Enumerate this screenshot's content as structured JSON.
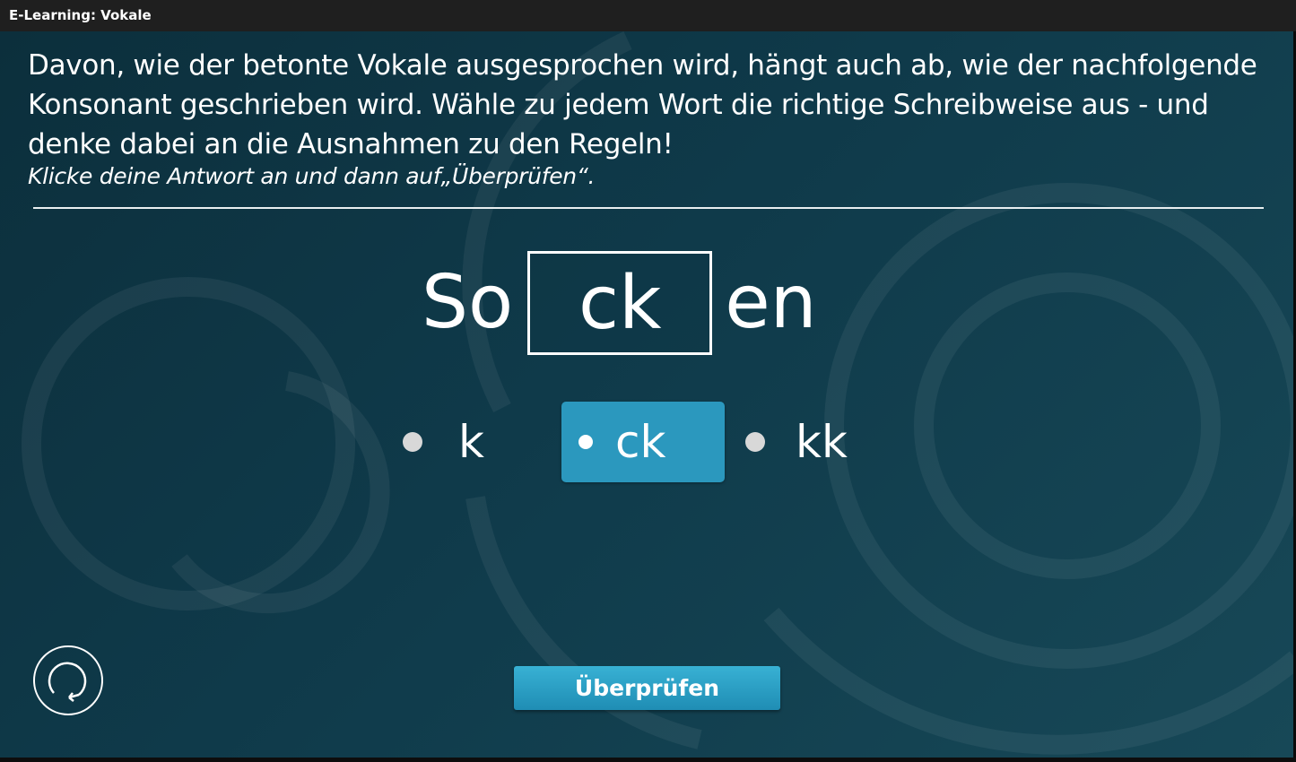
{
  "window": {
    "title": "E-Learning: Vokale"
  },
  "task": {
    "instruction": "Davon, wie der betonte Vokale ausgesprochen wird, hängt auch ab, wie der nachfolgende Konsonant geschrieben wird. Wähle zu jedem Wort die richtige Schreibweise aus - und denke dabei an die Ausnahmen zu den Regeln!",
    "hint": "Klicke deine Antwort an und dann auf„Überprüfen“."
  },
  "word": {
    "prefix": "So",
    "gap_value": "ck",
    "suffix": "en"
  },
  "options": [
    {
      "label": "k",
      "selected": false
    },
    {
      "label": "ck",
      "selected": true
    },
    {
      "label": "kk",
      "selected": false
    }
  ],
  "buttons": {
    "check_label": "Überprüfen",
    "reset_icon": "reset-icon"
  },
  "colors": {
    "background": "#0f3a4a",
    "accent": "#2b98be",
    "button": "#38b1d4"
  }
}
